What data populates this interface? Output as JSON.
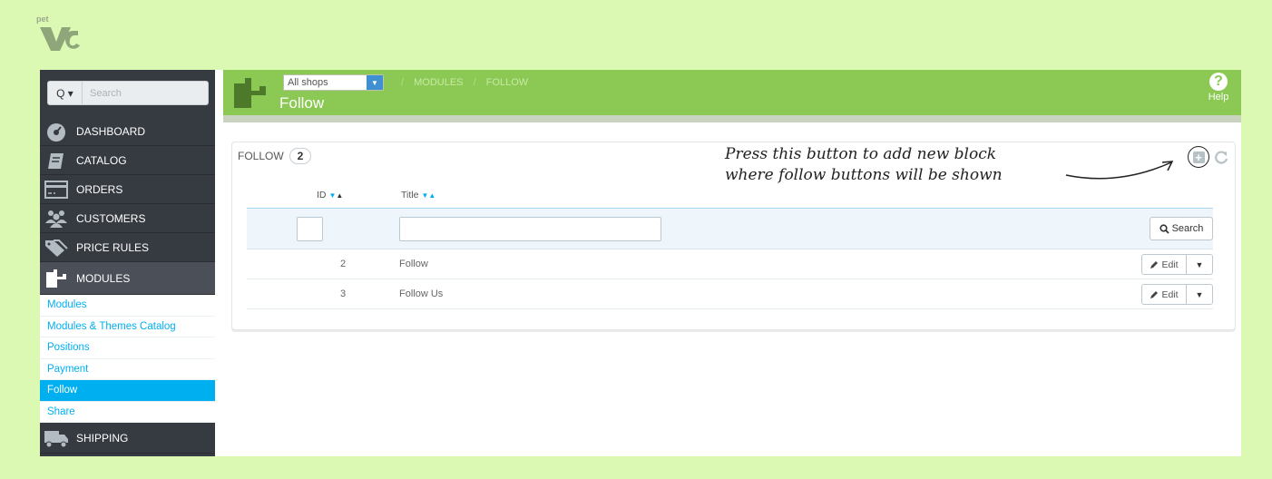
{
  "logo": {
    "small_text": "pet"
  },
  "sidebar": {
    "search_placeholder": "Search",
    "search_dropdown": "Q ▾",
    "nav": [
      {
        "label": "DASHBOARD",
        "icon": "dashboard-icon"
      },
      {
        "label": "CATALOG",
        "icon": "catalog-icon"
      },
      {
        "label": "ORDERS",
        "icon": "orders-icon"
      },
      {
        "label": "CUSTOMERS",
        "icon": "customers-icon"
      },
      {
        "label": "PRICE RULES",
        "icon": "price-rules-icon"
      },
      {
        "label": "MODULES",
        "icon": "modules-icon"
      },
      {
        "label": "SHIPPING",
        "icon": "shipping-icon"
      }
    ],
    "sub_items": [
      "Modules",
      "Modules & Themes Catalog",
      "Positions",
      "Payment",
      "Follow",
      "Share"
    ]
  },
  "header": {
    "shop_select": "All shops",
    "breadcrumb": [
      "MODULES",
      "FOLLOW"
    ],
    "breadcrumb_sep": "/",
    "title": "Follow",
    "help_label": "Help",
    "help_symbol": "?"
  },
  "panel": {
    "heading": "FOLLOW",
    "count": "2",
    "annotation_line1": "Press this button to add new block",
    "annotation_line2": "where follow buttons will be shown",
    "columns": {
      "id": "ID",
      "title": "Title"
    },
    "search_button": "Search",
    "rows": [
      {
        "id": "2",
        "title": "Follow",
        "action": "Edit"
      },
      {
        "id": "3",
        "title": "Follow Us",
        "action": "Edit"
      }
    ]
  },
  "colors": {
    "background": "#dcf9b4",
    "header": "#8bc954",
    "sidebar": "#363a41",
    "accent": "#00aff0"
  }
}
